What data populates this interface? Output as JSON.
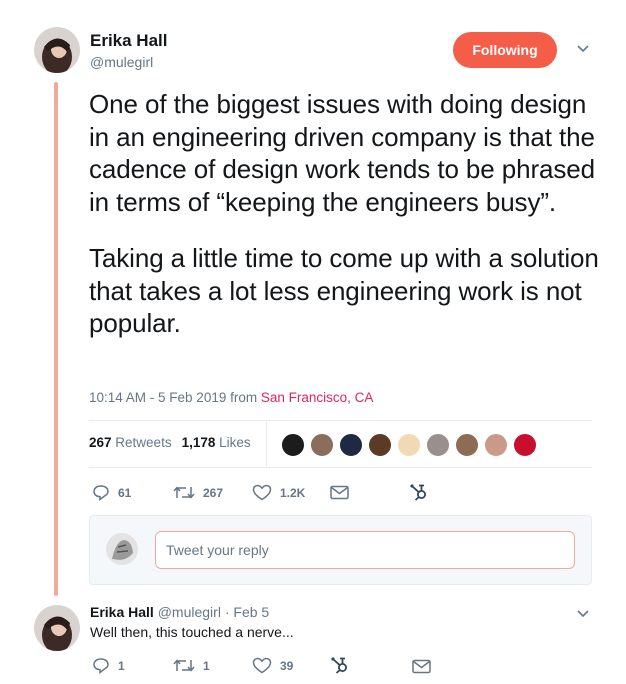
{
  "tweet": {
    "author_name": "Erika Hall",
    "author_handle": "@mulegirl",
    "follow_label": "Following",
    "text_p1": "One of the biggest issues with doing design in an engineering driven company is that the cadence of design work tends to be phrased in terms of “keeping the engineers busy”.",
    "text_p2": "Taking a little time to come up with a solution that takes a lot less engineering work is not popular.",
    "timestamp": "10:14 AM - 5 Feb 2019 from ",
    "location": "San Francisco, CA",
    "retweet_count": "267",
    "retweet_label": "Retweets",
    "like_count": "1,178",
    "like_label": "Likes",
    "actions": {
      "reply_count": "61",
      "retweet_count": "267",
      "like_count": "1.2K"
    }
  },
  "reply_composer": {
    "placeholder": "Tweet your reply"
  },
  "reply": {
    "author_name": "Erika Hall",
    "author_handle": "@mulegirl",
    "separator": "·",
    "date": "Feb 5",
    "text": "Well then, this touched a nerve...",
    "reply_count": "1",
    "retweet_count": "1",
    "like_count": "39"
  },
  "colors": {
    "accent": "#f45d48",
    "link": "#e0245e",
    "muted": "#657786",
    "thread": "#f4a99a"
  },
  "icons": [
    "reply-icon",
    "retweet-icon",
    "heart-icon",
    "mail-icon",
    "hubspot-icon",
    "chevron-down-icon"
  ]
}
